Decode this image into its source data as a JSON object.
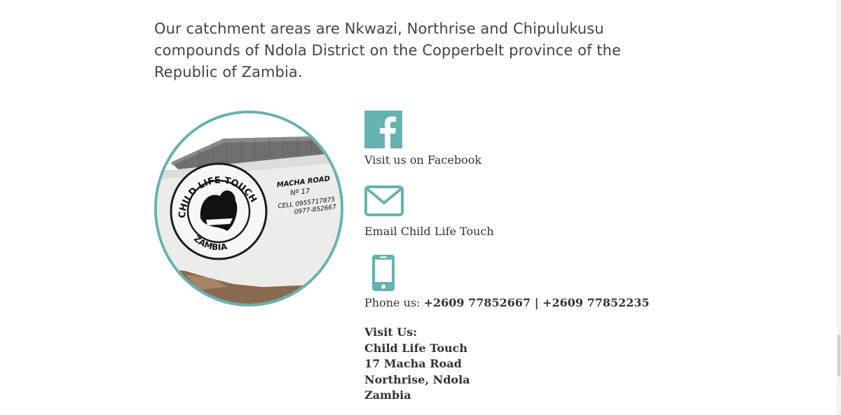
{
  "intro": {
    "text": "Our catchment areas are Nkwazi, Northrise and Chipulukusu compounds of Ndola District on the Copperbelt province of the Republic of Zambia."
  },
  "photo": {
    "wall_logo_text": "CHILD LIFE TOUCH",
    "wall_logo_country": "ZAMBIA",
    "wall_address_line1": "MACHA ROAD",
    "wall_address_line2": "Nº 17",
    "wall_cell_line1": "CELL 0955717875",
    "wall_cell_line2": "0977-852667"
  },
  "contact": {
    "facebook": {
      "icon": "facebook-icon",
      "label": "Visit us on Facebook"
    },
    "email": {
      "icon": "envelope-icon",
      "label": "Email Child Life Touch"
    },
    "phone": {
      "icon": "mobile-phone-icon",
      "prefix": "Phone us: ",
      "number1": "+2609 77852667",
      "separator": " | ",
      "number2": "+2609 77852235"
    },
    "address": {
      "heading": "Visit Us:",
      "line1": "Child Life Touch",
      "line2": "17 Macha Road",
      "line3": "Northrise, Ndola",
      "line4": "Zambia"
    }
  },
  "colors": {
    "accent": "#66b2b0",
    "text": "#444444"
  }
}
